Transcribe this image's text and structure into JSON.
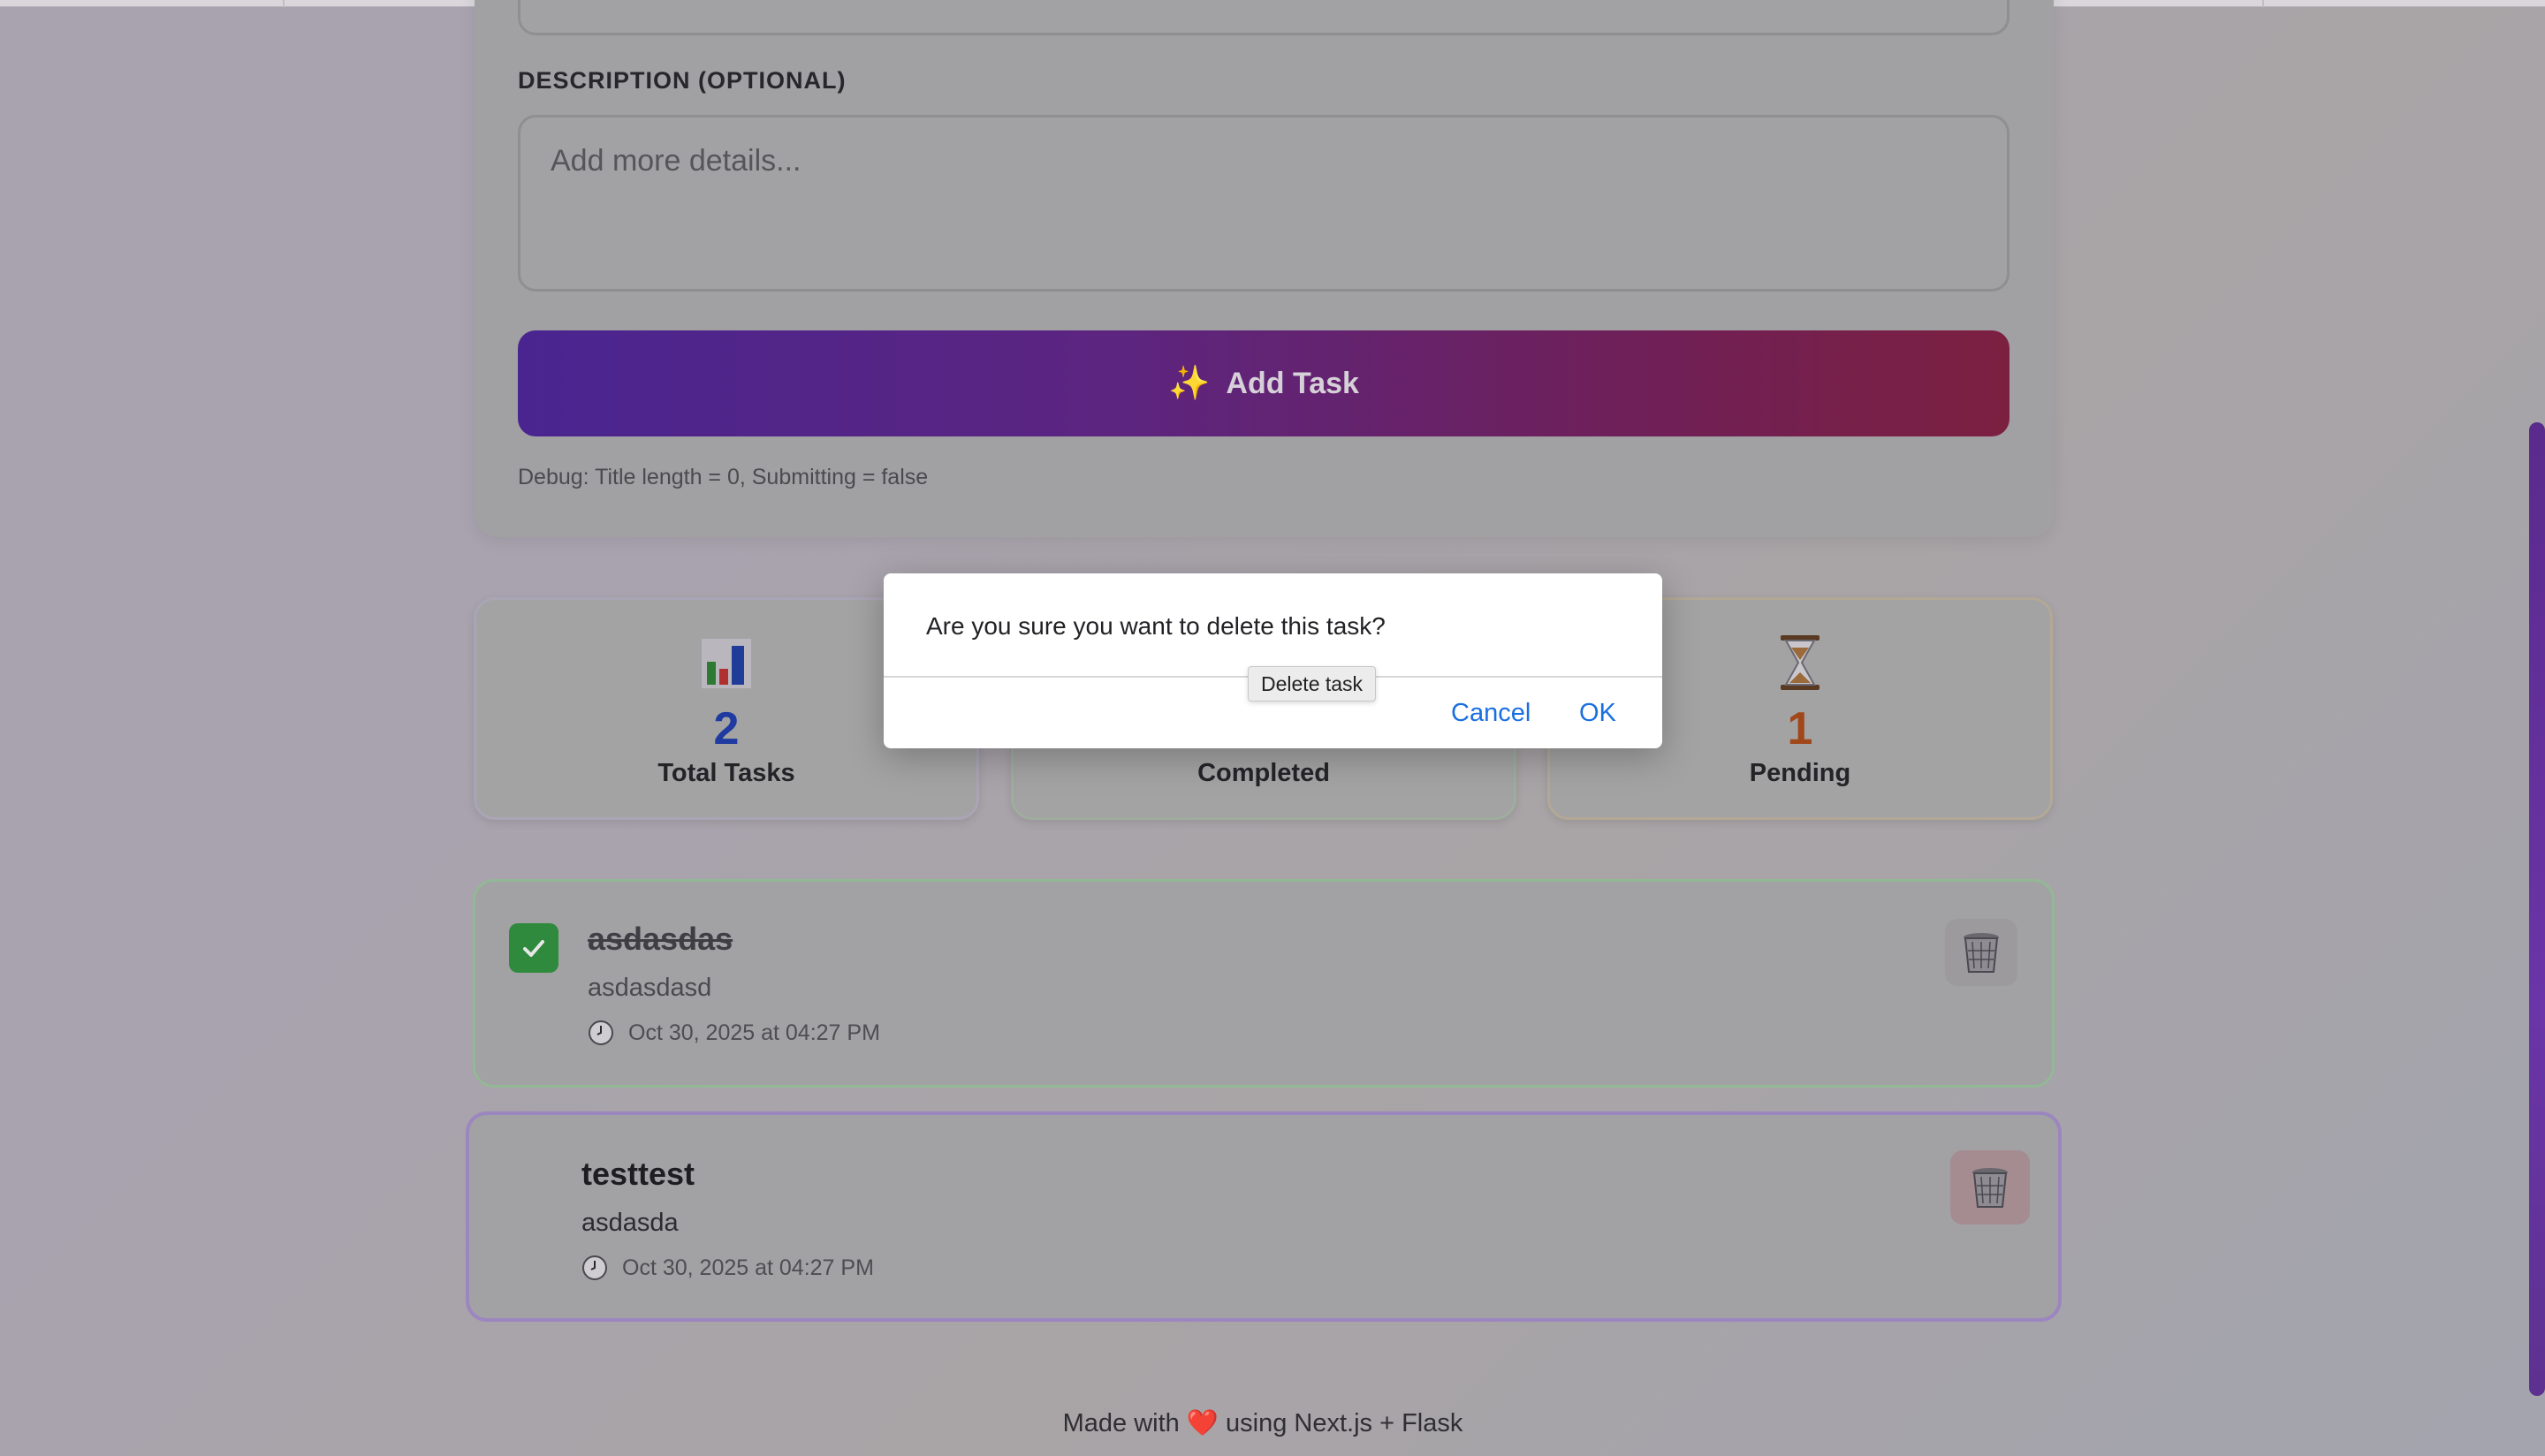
{
  "form": {
    "description_label": "DESCRIPTION (OPTIONAL)",
    "description_placeholder": "Add more details...",
    "add_button_icon": "✨",
    "add_button_label": "Add Task",
    "debug_text": "Debug: Title length = 0, Submitting = false"
  },
  "stats": {
    "total": {
      "icon": "bar-chart-icon",
      "value": "2",
      "label": "Total Tasks",
      "color": "#1f3aa0"
    },
    "completed": {
      "label": "Completed"
    },
    "pending": {
      "icon": "hourglass-icon",
      "value": "1",
      "label": "Pending",
      "color": "#a0481a"
    }
  },
  "tasks": [
    {
      "title": "asdasdas",
      "description": "asdasdasd",
      "timestamp": "Oct 30, 2025 at 04:27 PM",
      "completed": true
    },
    {
      "title": "testtest",
      "description": "asdasda",
      "timestamp": "Oct 30, 2025 at 04:27 PM",
      "completed": false
    }
  ],
  "footer": {
    "prefix": "Made with",
    "heart": "❤️",
    "suffix": "using Next.js + Flask"
  },
  "dialog": {
    "message": "Are you sure you want to delete this task?",
    "cancel_label": "Cancel",
    "ok_label": "OK"
  },
  "tooltip": {
    "text": "Delete task"
  },
  "colors": {
    "accent_start": "#4a2590",
    "accent_end": "#7c2040",
    "link": "#1a6fe0",
    "success": "#2f8a3e"
  }
}
